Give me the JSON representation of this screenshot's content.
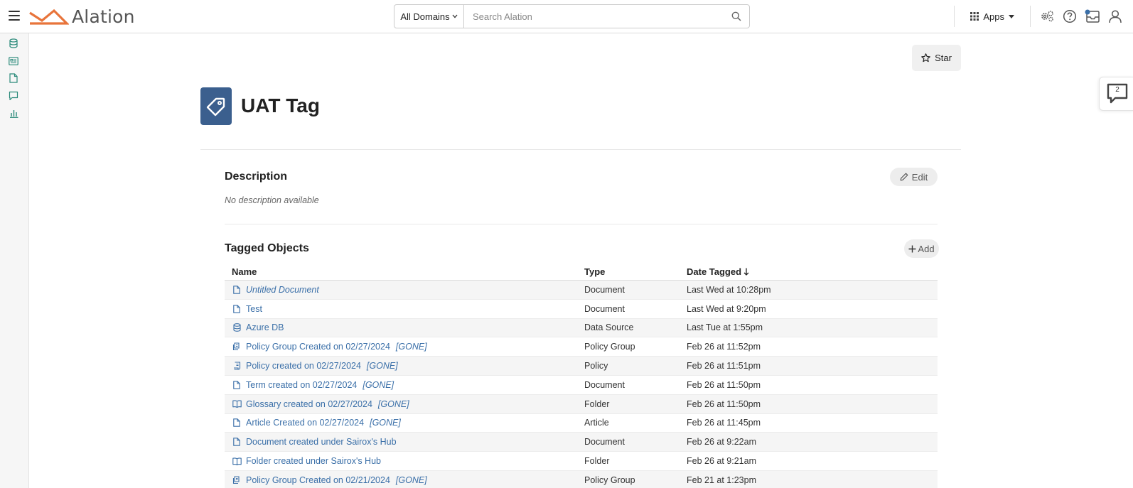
{
  "header": {
    "logo_text": "Alation",
    "domains_label": "All Domains",
    "search_placeholder": "Search Alation",
    "apps_label": "Apps"
  },
  "floating_chat": {
    "count": "2"
  },
  "star_label": "Star",
  "page_title": "UAT Tag",
  "description": {
    "title": "Description",
    "edit_label": "Edit",
    "text": "No description available"
  },
  "tagged_objects": {
    "title": "Tagged Objects",
    "add_label": "Add",
    "columns": {
      "name": "Name",
      "type": "Type",
      "date": "Date Tagged"
    },
    "rows": [
      {
        "name": "Untitled Document",
        "gone": "",
        "type": "Document",
        "date": "Last Wed at 10:28pm",
        "icon": "document-icon",
        "italic": true
      },
      {
        "name": "Test",
        "gone": "",
        "type": "Document",
        "date": "Last Wed at 9:20pm",
        "icon": "document-icon",
        "italic": false
      },
      {
        "name": "Azure DB",
        "gone": "",
        "type": "Data Source",
        "date": "Last Tue at 1:55pm",
        "icon": "database-icon",
        "italic": false
      },
      {
        "name": "Policy Group Created on 02/27/2024",
        "gone": "[GONE]",
        "type": "Policy Group",
        "date": "Feb 26 at 11:52pm",
        "icon": "policy-group-icon",
        "italic": false
      },
      {
        "name": "Policy created on 02/27/2024",
        "gone": "[GONE]",
        "type": "Policy",
        "date": "Feb 26 at 11:51pm",
        "icon": "policy-icon",
        "italic": false
      },
      {
        "name": "Term created on 02/27/2024",
        "gone": "[GONE]",
        "type": "Document",
        "date": "Feb 26 at 11:50pm",
        "icon": "document-icon",
        "italic": false
      },
      {
        "name": "Glossary created on 02/27/2024",
        "gone": "[GONE]",
        "type": "Folder",
        "date": "Feb 26 at 11:50pm",
        "icon": "book-icon",
        "italic": false
      },
      {
        "name": "Article Created on 02/27/2024",
        "gone": "[GONE]",
        "type": "Article",
        "date": "Feb 26 at 11:45pm",
        "icon": "document-icon",
        "italic": false
      },
      {
        "name": "Document created under Sairox's Hub",
        "gone": "",
        "type": "Document",
        "date": "Feb 26 at 9:22am",
        "icon": "document-icon",
        "italic": false
      },
      {
        "name": "Folder created under Sairox's Hub",
        "gone": "",
        "type": "Folder",
        "date": "Feb 26 at 9:21am",
        "icon": "book-icon",
        "italic": false
      },
      {
        "name": "Policy Group Created on 02/21/2024",
        "gone": "[GONE]",
        "type": "Policy Group",
        "date": "Feb 21 at 1:23pm",
        "icon": "policy-group-icon",
        "italic": false
      }
    ]
  },
  "colors": {
    "accent_orange": "#e8743b",
    "link_blue": "#3a6fa8",
    "tag_tile": "#3b5f8e",
    "sidebar_icon": "#2a8a7a"
  }
}
